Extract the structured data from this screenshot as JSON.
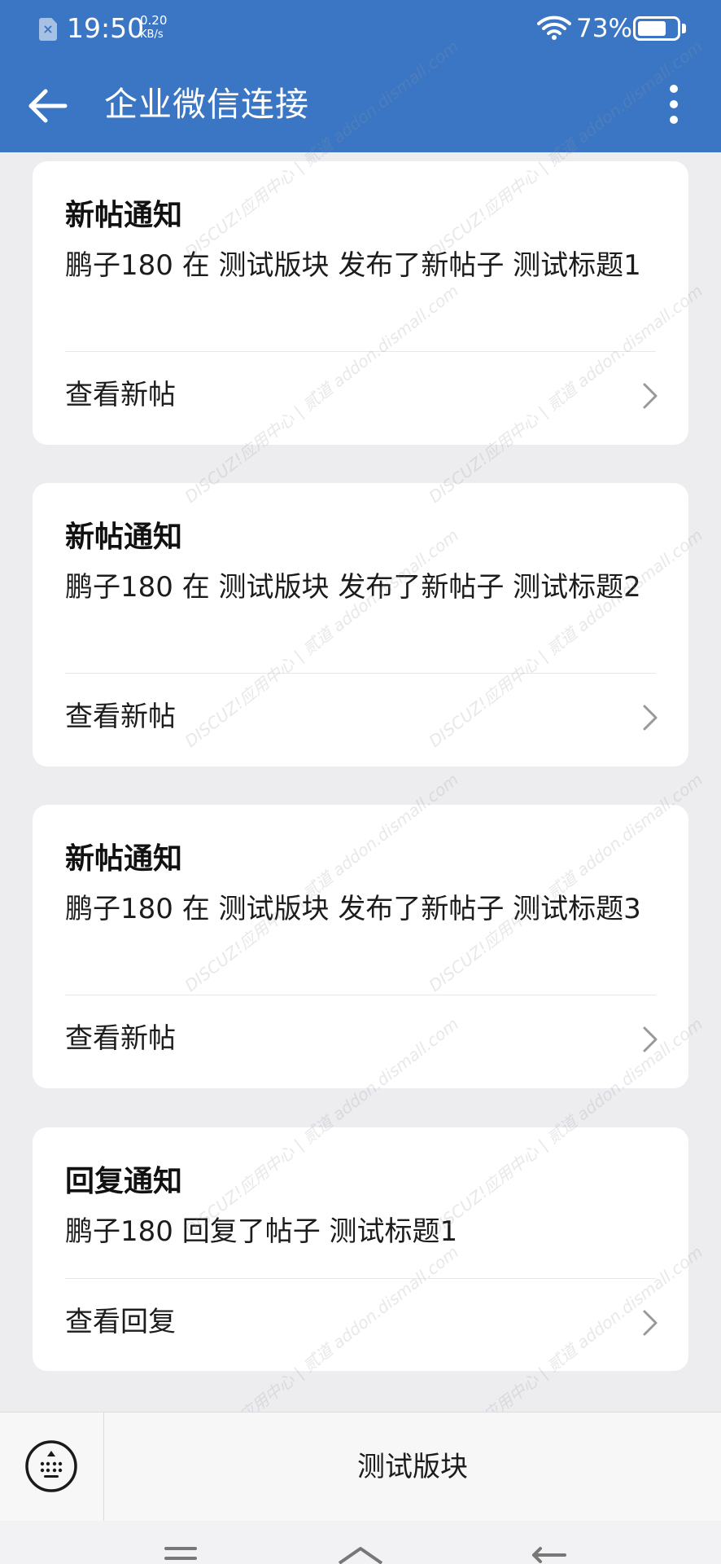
{
  "status_bar": {
    "time": "19:50",
    "net_speed_value": "0.20",
    "net_speed_unit": "KB/s",
    "battery_percent": "73%",
    "battery_level": 0.73
  },
  "app_bar": {
    "title": "企业微信连接"
  },
  "cards": [
    {
      "title": "新帖通知",
      "body": "鹏子180 在 测试版块 发布了新帖子 测试标题1",
      "action": "查看新帖"
    },
    {
      "title": "新帖通知",
      "body": "鹏子180 在 测试版块 发布了新帖子 测试标题2",
      "action": "查看新帖"
    },
    {
      "title": "新帖通知",
      "body": "鹏子180 在 测试版块 发布了新帖子 测试标题3",
      "action": "查看新帖"
    },
    {
      "title": "回复通知",
      "body": "鹏子180 回复了帖子 测试标题1",
      "action": "查看回复"
    }
  ],
  "bottom_menu": {
    "item": "测试版块"
  },
  "watermark": {
    "text": "DISCUZ!应用中心 | 贰道 addon.dismall.com"
  },
  "colors": {
    "primary": "#3a76c4",
    "background": "#ededf0",
    "card": "#ffffff"
  }
}
